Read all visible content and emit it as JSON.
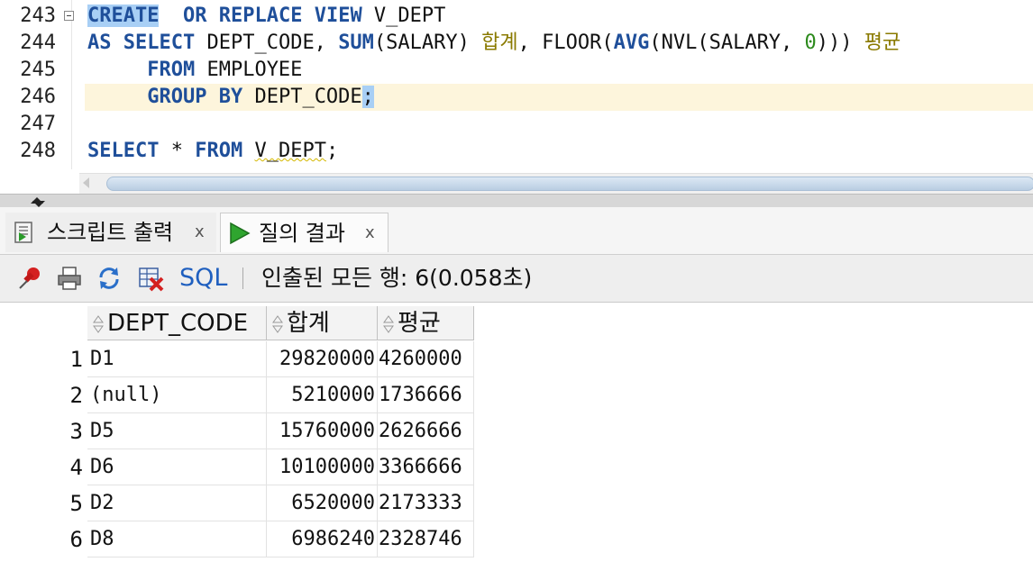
{
  "editor": {
    "lines": [
      {
        "num": "243",
        "t": [
          [
            "kw sel",
            "CREATE"
          ],
          [
            "",
            "  "
          ],
          [
            "kw",
            "OR"
          ],
          [
            "",
            ""
          ],
          [
            "",
            " "
          ],
          [
            "kw",
            "REPLACE"
          ],
          [
            "",
            " "
          ],
          [
            "kw",
            "VIEW"
          ],
          [
            "",
            " V_DEPT"
          ]
        ]
      },
      {
        "num": "244",
        "t": [
          [
            "kw",
            "AS"
          ],
          [
            "",
            " "
          ],
          [
            "kw",
            "SELECT"
          ],
          [
            "",
            " DEPT_CODE, "
          ],
          [
            "kw",
            "SUM"
          ],
          [
            "",
            "(SALARY) "
          ],
          [
            "kor",
            "합계"
          ],
          [
            "",
            ", FLOOR("
          ],
          [
            "kw",
            "AVG"
          ],
          [
            "",
            "(NVL(SALARY, "
          ],
          [
            "num",
            "0"
          ],
          [
            "",
            "))) "
          ],
          [
            "kor",
            "평균"
          ]
        ]
      },
      {
        "num": "245",
        "t": [
          [
            "",
            "     "
          ],
          [
            "kw",
            "FROM"
          ],
          [
            "",
            " EMPLOYEE"
          ]
        ]
      },
      {
        "num": "246",
        "t": [
          [
            "",
            "     "
          ],
          [
            "kw",
            "GROUP"
          ],
          [
            "",
            " "
          ],
          [
            "kw",
            "BY"
          ],
          [
            "",
            " DEPT_CODE"
          ],
          [
            "sel",
            ";"
          ]
        ]
      },
      {
        "num": "247",
        "t": []
      },
      {
        "num": "248",
        "t": [
          [
            "kw",
            "SELECT"
          ],
          [
            "",
            " * "
          ],
          [
            "kw",
            "FROM"
          ],
          [
            "",
            " "
          ],
          [
            "squig",
            "V_DEPT"
          ],
          [
            "",
            ";"
          ]
        ]
      }
    ]
  },
  "tabs": [
    {
      "label": "스크립트 출력",
      "close": "x"
    },
    {
      "label": "질의 결과",
      "close": "x"
    }
  ],
  "toolbar": {
    "sql_label": "SQL",
    "status": "인출된 모든 행: 6(0.058초)"
  },
  "grid": {
    "columns": [
      "DEPT_CODE",
      "합계",
      "평균"
    ],
    "rows": [
      {
        "n": "1",
        "dept": "D1",
        "sum": "29820000",
        "avg": "4260000"
      },
      {
        "n": "2",
        "dept": "(null)",
        "sum": "5210000",
        "avg": "1736666"
      },
      {
        "n": "3",
        "dept": "D5",
        "sum": "15760000",
        "avg": "2626666"
      },
      {
        "n": "4",
        "dept": "D6",
        "sum": "10100000",
        "avg": "3366666"
      },
      {
        "n": "5",
        "dept": "D2",
        "sum": "6520000",
        "avg": "2173333"
      },
      {
        "n": "6",
        "dept": "D8",
        "sum": "6986240",
        "avg": "2328746"
      }
    ]
  },
  "colors": {
    "keyword": "#1f4f9a",
    "korean_alias": "#8a7a00",
    "number_literal": "#2c8a1c",
    "current_line": "#fdf5dc",
    "selection": "#a8cff5",
    "sql_link": "#1f5fbf"
  },
  "icons": {
    "tab1": "script-output-icon",
    "tab2": "run-query-icon",
    "toolbar": [
      "pin-icon",
      "print-icon",
      "refresh-icon",
      "clear-icon"
    ]
  }
}
